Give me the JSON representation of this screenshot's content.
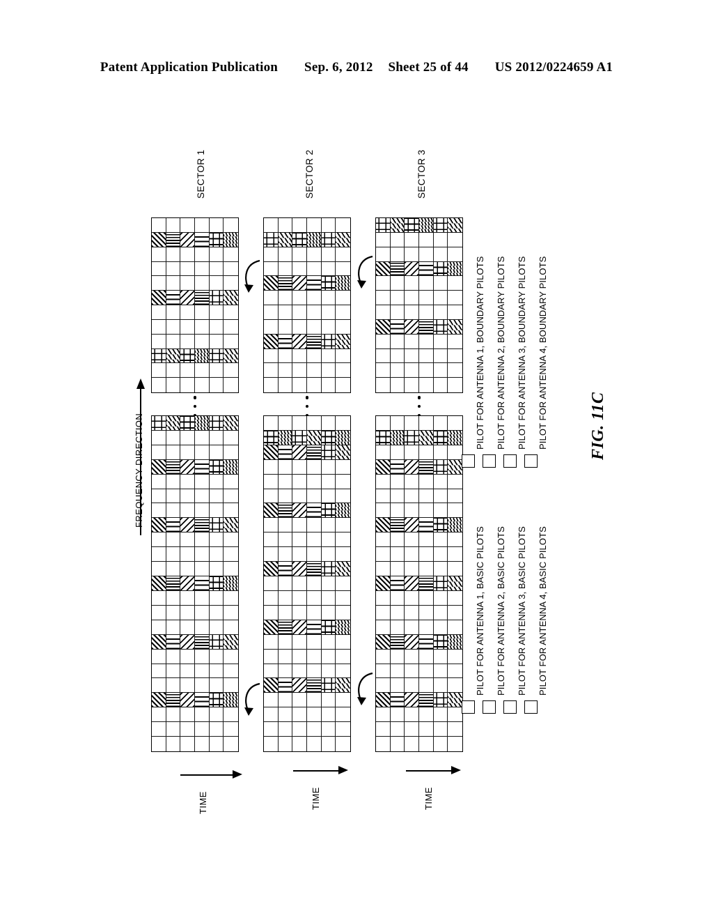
{
  "header": {
    "publication": "Patent Application Publication",
    "date": "Sep. 6, 2012",
    "sheet": "Sheet 25 of 44",
    "number": "US 2012/0224659 A1"
  },
  "figure": {
    "name": "FIG. 11C",
    "frequency_axis_label": "FREQUENCY DIRECTION",
    "sectors": [
      {
        "label": "SECTOR 1",
        "time_label": "TIME"
      },
      {
        "label": "SECTOR 2",
        "time_label": "TIME"
      },
      {
        "label": "SECTOR 3",
        "time_label": "TIME"
      }
    ],
    "ellipsis": "⋮"
  },
  "legend": {
    "boundary": [
      {
        "pattern": "y1",
        "text": "PILOT FOR ANTENNA 1, BOUNDARY PILOTS"
      },
      {
        "pattern": "y2",
        "text": "PILOT FOR ANTENNA 2, BOUNDARY PILOTS"
      },
      {
        "pattern": "y3",
        "text": "PILOT FOR ANTENNA 3, BOUNDARY PILOTS"
      },
      {
        "pattern": "y4",
        "text": "PILOT FOR ANTENNA 4, BOUNDARY PILOTS"
      }
    ],
    "basic": [
      {
        "pattern": "b1",
        "text": "PILOT FOR ANTENNA 1, BASIC PILOTS"
      },
      {
        "pattern": "b2",
        "text": "PILOT FOR ANTENNA 2, BASIC PILOTS"
      },
      {
        "pattern": "b3",
        "text": "PILOT FOR ANTENNA 3, BASIC PILOTS"
      },
      {
        "pattern": "b4",
        "text": "PILOT FOR ANTENNA 4, BASIC PILOTS"
      }
    ]
  },
  "chart_data": {
    "type": "heatmap",
    "title": "FIG. 11C",
    "description": "Pilot symbol allocation grids for three sectors. Each grid is a time-frequency resource map; rows run along the TIME axis and columns along the FREQUENCY DIRECTION axis. Filled cells carry antenna pilot patterns.",
    "xlabel": "TIME",
    "ylabel": "FREQUENCY DIRECTION",
    "grid_columns": 6,
    "pattern_key": {
      "b1": "PILOT FOR ANTENNA 1, BASIC PILOTS",
      "b2": "PILOT FOR ANTENNA 2, BASIC PILOTS",
      "b3": "PILOT FOR ANTENNA 3, BASIC PILOTS",
      "b4": "PILOT FOR ANTENNA 4, BASIC PILOTS",
      "y1": "PILOT FOR ANTENNA 1, BOUNDARY PILOTS",
      "y2": "PILOT FOR ANTENNA 2, BOUNDARY PILOTS",
      "y3": "PILOT FOR ANTENNA 3, BOUNDARY PILOTS",
      "y4": "PILOT FOR ANTENNA 4, BOUNDARY PILOTS"
    },
    "panels": [
      {
        "sector": "SECTOR 1",
        "part": "first",
        "rows": 23,
        "cols": 6,
        "filled_rows": [
          {
            "row": 0,
            "patterns": [
              "y1",
              "y3",
              "y2",
              "y4",
              "y1",
              "y3"
            ]
          },
          {
            "row": 3,
            "patterns": [
              "b1",
              "b4",
              "b2",
              "b3",
              "y2",
              "y4"
            ]
          },
          {
            "row": 7,
            "patterns": [
              "b1",
              "b3",
              "b2",
              "b4",
              "y1",
              "y3"
            ]
          },
          {
            "row": 11,
            "patterns": [
              "b1",
              "b4",
              "b2",
              "b3",
              "y2",
              "y4"
            ]
          },
          {
            "row": 15,
            "patterns": [
              "b1",
              "b3",
              "b2",
              "b4",
              "y1",
              "y3"
            ]
          },
          {
            "row": 19,
            "patterns": [
              "b1",
              "b4",
              "b2",
              "b3",
              "y2",
              "y4"
            ]
          }
        ]
      },
      {
        "sector": "SECTOR 1",
        "part": "second",
        "rows": 12,
        "cols": 6,
        "filled_rows": [
          {
            "row": 1,
            "patterns": [
              "b1",
              "b4",
              "b2",
              "b3",
              "y2",
              "y4"
            ]
          },
          {
            "row": 5,
            "patterns": [
              "b1",
              "b3",
              "b2",
              "b4",
              "y1",
              "y3"
            ]
          },
          {
            "row": 9,
            "patterns": [
              "y1",
              "y3",
              "y2",
              "y4",
              "y1",
              "y3"
            ]
          }
        ]
      },
      {
        "sector": "SECTOR 2",
        "part": "first",
        "rows": 23,
        "cols": 6,
        "filled_rows": [
          {
            "row": 1,
            "patterns": [
              "y2",
              "y4",
              "y1",
              "y3",
              "y2",
              "y4"
            ]
          },
          {
            "row": 2,
            "patterns": [
              "b1",
              "b3",
              "b2",
              "b4",
              "y1",
              "y3"
            ]
          },
          {
            "row": 6,
            "patterns": [
              "b1",
              "b4",
              "b2",
              "b3",
              "y2",
              "y4"
            ]
          },
          {
            "row": 10,
            "patterns": [
              "b1",
              "b3",
              "b2",
              "b4",
              "y1",
              "y3"
            ]
          },
          {
            "row": 14,
            "patterns": [
              "b1",
              "b4",
              "b2",
              "b3",
              "y2",
              "y4"
            ]
          },
          {
            "row": 18,
            "patterns": [
              "b1",
              "b3",
              "b2",
              "b4",
              "y1",
              "y3"
            ]
          }
        ]
      },
      {
        "sector": "SECTOR 2",
        "part": "second",
        "rows": 12,
        "cols": 6,
        "filled_rows": [
          {
            "row": 1,
            "patterns": [
              "y1",
              "y3",
              "y2",
              "y4",
              "y1",
              "y3"
            ]
          },
          {
            "row": 4,
            "patterns": [
              "b1",
              "b4",
              "b2",
              "b3",
              "y2",
              "y4"
            ]
          },
          {
            "row": 8,
            "patterns": [
              "b1",
              "b3",
              "b2",
              "b4",
              "y1",
              "y3"
            ]
          }
        ]
      },
      {
        "sector": "SECTOR 3",
        "part": "first",
        "rows": 23,
        "cols": 6,
        "filled_rows": [
          {
            "row": 1,
            "patterns": [
              "y2",
              "y4",
              "y1",
              "y3",
              "y2",
              "y4"
            ]
          },
          {
            "row": 3,
            "patterns": [
              "b1",
              "b3",
              "b2",
              "b4",
              "y1",
              "y3"
            ]
          },
          {
            "row": 7,
            "patterns": [
              "b1",
              "b4",
              "b2",
              "b3",
              "y2",
              "y4"
            ]
          },
          {
            "row": 11,
            "patterns": [
              "b1",
              "b3",
              "b2",
              "b4",
              "y1",
              "y3"
            ]
          },
          {
            "row": 15,
            "patterns": [
              "b1",
              "b4",
              "b2",
              "b3",
              "y2",
              "y4"
            ]
          },
          {
            "row": 19,
            "patterns": [
              "b1",
              "b3",
              "b2",
              "b4",
              "y1",
              "y3"
            ]
          }
        ]
      },
      {
        "sector": "SECTOR 3",
        "part": "second",
        "rows": 12,
        "cols": 6,
        "filled_rows": [
          {
            "row": 0,
            "patterns": [
              "y1",
              "y3",
              "y2",
              "y4",
              "y1",
              "y3"
            ]
          },
          {
            "row": 3,
            "patterns": [
              "b1",
              "b4",
              "b2",
              "b3",
              "y2",
              "y4"
            ]
          },
          {
            "row": 7,
            "patterns": [
              "b1",
              "b3",
              "b2",
              "b4",
              "y1",
              "y3"
            ]
          }
        ]
      }
    ]
  }
}
